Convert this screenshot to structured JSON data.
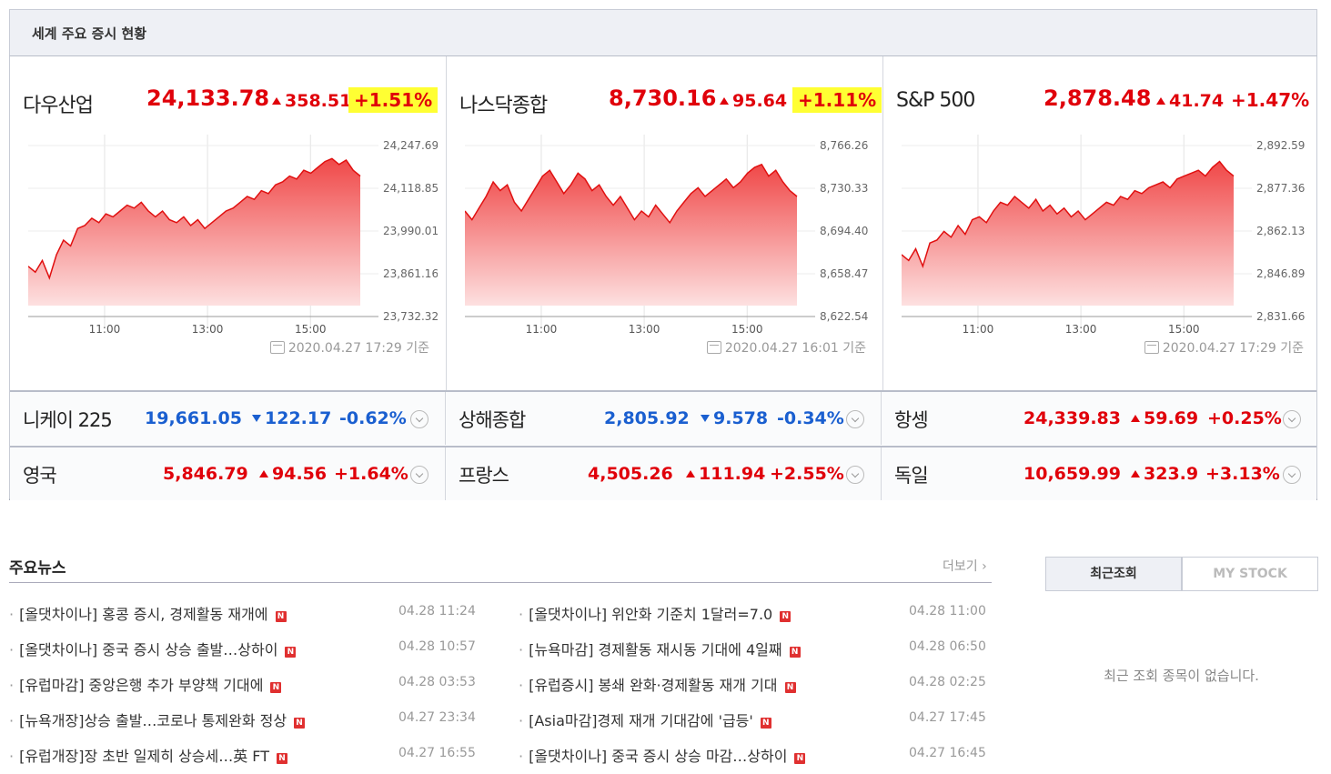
{
  "header": {
    "title": "세계 주요 증시 현황"
  },
  "main_indices": [
    {
      "name": "다우산업",
      "value": "24,133.78",
      "change": "358.51",
      "percent": "+1.51%",
      "highlight": true,
      "asof": "2020.04.27 17:29 기준",
      "y_ticks": [
        "24,247.69",
        "24,118.85",
        "23,990.01",
        "23,861.16",
        "23,732.32"
      ],
      "x_ticks": [
        "11:00",
        "13:00",
        "15:00"
      ]
    },
    {
      "name": "나스닥종합",
      "value": "8,730.16",
      "change": "95.64",
      "percent": "+1.11%",
      "highlight": true,
      "asof": "2020.04.27 16:01 기준",
      "y_ticks": [
        "8,766.26",
        "8,730.33",
        "8,694.40",
        "8,658.47",
        "8,622.54"
      ],
      "x_ticks": [
        "11:00",
        "13:00",
        "15:00"
      ]
    },
    {
      "name": "S&P 500",
      "value": "2,878.48",
      "change": "41.74",
      "percent": "+1.47%",
      "highlight": false,
      "asof": "2020.04.27 17:29 기준",
      "y_ticks": [
        "2,892.59",
        "2,877.36",
        "2,862.13",
        "2,846.89",
        "2,831.66"
      ],
      "x_ticks": [
        "11:00",
        "13:00",
        "15:00"
      ]
    }
  ],
  "other_indices": [
    {
      "name": "니케이 225",
      "value": "19,661.05",
      "change": "122.17",
      "percent": "-0.62%",
      "dir": "down"
    },
    {
      "name": "상해종합",
      "value": "2,805.92",
      "change": "9.578",
      "percent": "-0.34%",
      "dir": "down"
    },
    {
      "name": "항셍",
      "value": "24,339.83",
      "change": "59.69",
      "percent": "+0.25%",
      "dir": "up"
    },
    {
      "name": "영국",
      "value": "5,846.79",
      "change": "94.56",
      "percent": "+1.64%",
      "dir": "up"
    },
    {
      "name": "프랑스",
      "value": "4,505.26",
      "change": "111.94",
      "percent": "+2.55%",
      "dir": "up"
    },
    {
      "name": "독일",
      "value": "10,659.99",
      "change": "323.9",
      "percent": "+3.13%",
      "dir": "up"
    }
  ],
  "news": {
    "title": "주요뉴스",
    "more_label": "더보기",
    "badge": "N",
    "items": [
      {
        "text": "[올댓차이나] 홍콩 증시, 경제활동 재개에",
        "date": "04.28 11:24"
      },
      {
        "text": "[올댓차이나] 위안화 기준치 1달러=7.0",
        "date": "04.28 11:00"
      },
      {
        "text": "[올댓차이나] 중국 증시 상승 출발…상하이",
        "date": "04.28 10:57"
      },
      {
        "text": "[뉴욕마감] 경제활동 재시동 기대에 4일째",
        "date": "04.28 06:50"
      },
      {
        "text": "[유럽마감] 중앙은행 추가 부양책 기대에",
        "date": "04.28 03:53"
      },
      {
        "text": "[유럽증시] 봉쇄 완화·경제활동 재개 기대",
        "date": "04.28 02:25"
      },
      {
        "text": "[뉴욕개장]상승 출발…코로나 통제완화 정상",
        "date": "04.27 23:34"
      },
      {
        "text": "[Asia마감]경제 재개 기대감에 '급등'",
        "date": "04.27 17:45"
      },
      {
        "text": "[유럽개장]장 초반 일제히 상승세…英 FT",
        "date": "04.27 16:55"
      },
      {
        "text": "[올댓차이나] 중국 증시 상승 마감…상하이",
        "date": "04.27 16:45"
      }
    ]
  },
  "side": {
    "tab_recent": "최근조회",
    "tab_mystock": "MY STOCK",
    "empty_message": "최근 조회 종목이 없습니다."
  }
}
